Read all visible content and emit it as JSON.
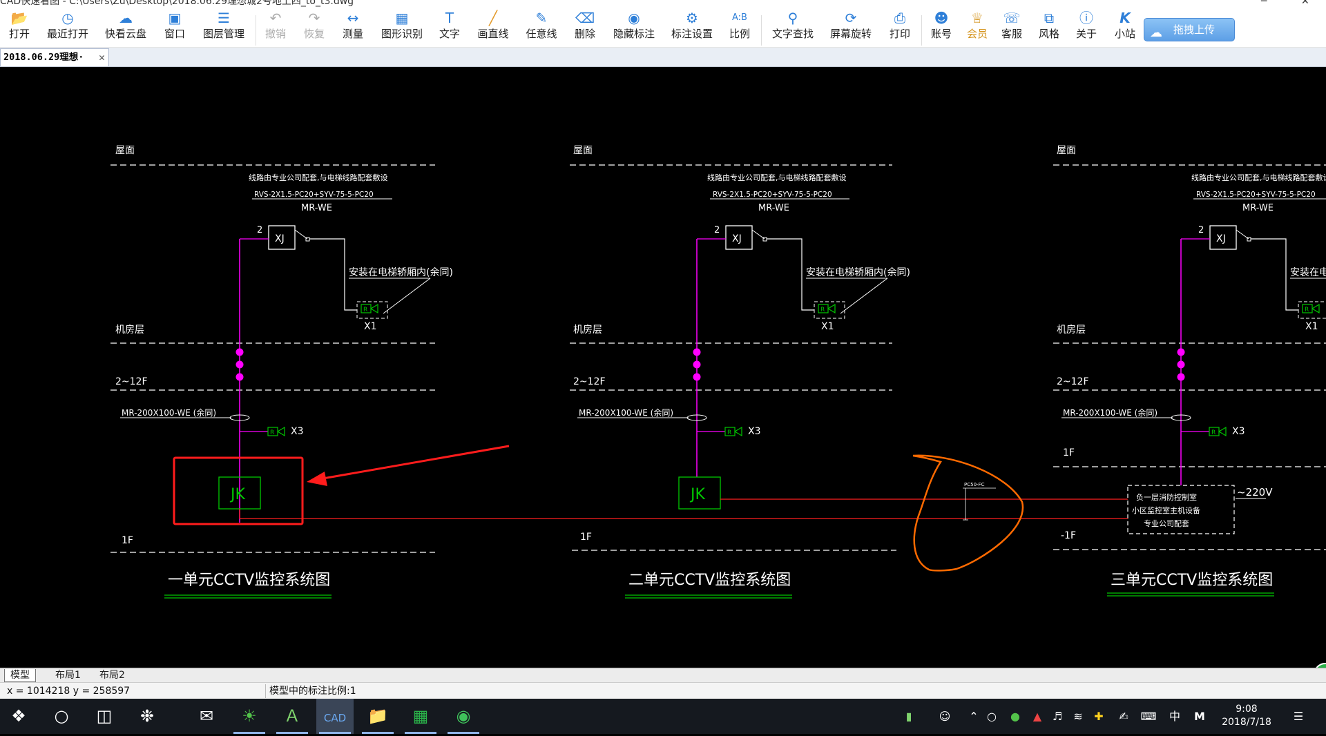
{
  "window": {
    "title": "CAD快速看图 - C:\\Users\\Zu\\Desktop\\2018.06.29理想城2号地上四_to_t3.dwg",
    "minimize": "─",
    "close": "✕"
  },
  "toolbar": {
    "open": "打开",
    "recent": "最近打开",
    "cloud": "快看云盘",
    "window": "窗口",
    "layers": "图层管理",
    "undo": "撤销",
    "redo": "恢复",
    "measure": "测量",
    "shape_recognize": "图形识别",
    "text": "文字",
    "line": "画直线",
    "freeline": "任意线",
    "delete": "删除",
    "hide_dim": "隐藏标注",
    "dim_settings": "标注设置",
    "scale": "比例",
    "find_text": "文字查找",
    "rotate": "屏幕旋转",
    "print": "打印",
    "account": "账号",
    "vip": "会员",
    "service": "客服",
    "style": "风格",
    "about": "关于",
    "station": "小站",
    "upload": "拖拽上传"
  },
  "icons": {
    "open": "folder-icon",
    "recent": "clock-icon",
    "cloud": "cloud-icon",
    "window": "fit-window-icon",
    "layers": "layers-icon",
    "undo": "undo-icon",
    "redo": "redo-icon",
    "measure": "ruler-icon",
    "shape_recognize": "shape-recognize-icon",
    "text": "text-icon",
    "line": "line-icon",
    "freeline": "pen-icon",
    "delete": "eraser-icon",
    "hide_dim": "eye-icon",
    "dim_settings": "gear-icon",
    "scale": "scale-icon",
    "find_text": "search-icon",
    "rotate": "rotate-icon",
    "print": "printer-icon",
    "account": "user-icon",
    "vip": "vip-icon",
    "service": "headset-icon",
    "style": "style-icon",
    "about": "info-icon",
    "station": "station-icon",
    "upload": "upload-icon"
  },
  "tab": {
    "name": "2018.06.29理想·",
    "close": "✕"
  },
  "drawing": {
    "units": [
      {
        "roof": "屋面",
        "cable_note": "线路由专业公司配套,与电梯线路配套敷设",
        "cable_spec": "RVS-2X1.5-PC20+SYV-75-5-PC20",
        "mr": "MR-WE",
        "count": "2",
        "xj": "XJ",
        "install": "安装在电梯轿厢内(余同)",
        "cam": "R",
        "x1": "X1",
        "machine_room": "机房层",
        "floors": "2~12F",
        "tray": "MR-200X100-WE (余同)",
        "x3": "X3",
        "jk": "JK",
        "ground": "1F",
        "title": "一单元CCTV监控系统图"
      },
      {
        "roof": "屋面",
        "cable_note": "线路由专业公司配套,与电梯线路配套敷设",
        "cable_spec": "RVS-2X1.5-PC20+SYV-75-5-PC20",
        "mr": "MR-WE",
        "count": "2",
        "xj": "XJ",
        "install": "安装在电梯轿厢内(余同)",
        "cam": "R",
        "x1": "X1",
        "machine_room": "机房层",
        "floors": "2~12F",
        "tray": "MR-200X100-WE (余同)",
        "x3": "X3",
        "jk": "JK",
        "ground": "1F",
        "title": "二单元CCTV监控系统图"
      },
      {
        "roof": "屋面",
        "cable_note": "线路由专业公司配套,与电梯线路配套敷设",
        "cable_spec": "RVS-2X1.5-PC20+SYV-75-5-PC20",
        "mr": "MR-WE",
        "count": "2",
        "xj": "XJ",
        "install": "安装在电梯轿厢内(余同)",
        "cam": "R",
        "x1": "X1",
        "machine_room": "机房层",
        "floors": "2~12F",
        "tray": "MR-200X100-WE (余同)",
        "x3": "X3",
        "ground": "1F",
        "basement": "-1F",
        "control_room_1": "负一层消防控制室",
        "control_room_2": "小区监控室主机设备",
        "control_room_3": "专业公司配套",
        "power": "~220V",
        "title": "三单元CCTV监控系统图"
      }
    ],
    "mid_label": "PC50-FC"
  },
  "layout_tabs": [
    "模型",
    "布局1",
    "布局2"
  ],
  "status": {
    "coords": "x = 1014218  y = 258597",
    "scale": "模型中的标注比例:1"
  },
  "taskbar": {
    "time": "9:08",
    "date": "2018/7/18",
    "ime": "中",
    "ime2": "M"
  },
  "colors": {
    "magenta": "#ff00ff",
    "green": "#00c800",
    "red": "#ff2020",
    "orange": "#ff6a00",
    "white": "#ffffff"
  }
}
